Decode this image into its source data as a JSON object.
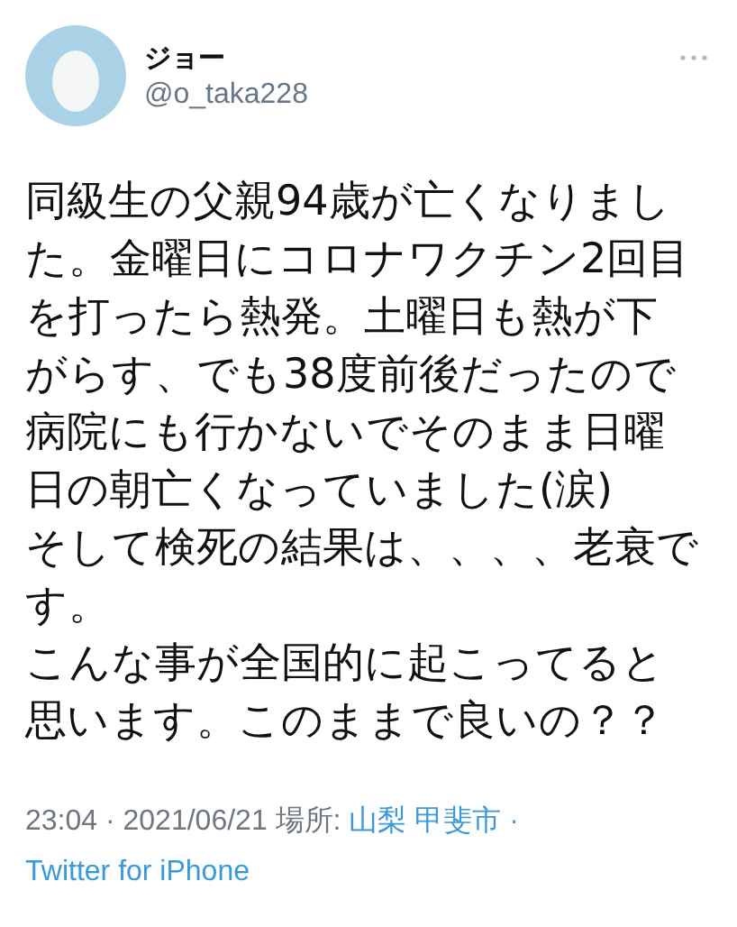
{
  "author": {
    "name": "ジョー",
    "handle": "@o_taka228"
  },
  "body": [
    "同級生の父親94歳が亡くなりました。金曜日にコロナワクチン2回目を打ったら熱発。土曜日も熱が下がらす、でも38度前後だったので病院にも行かないでそのまま日曜日の朝亡くなっていました(涙)",
    "そして検死の結果は、、、、老衰です。",
    "こんな事が全国的に起こってると思います。このままで良いの？？"
  ],
  "meta": {
    "time": "23:04 · 2021/06/21 場所: ",
    "location": "山梨 甲斐市",
    "separator": " · ",
    "source": "Twitter for iPhone"
  }
}
